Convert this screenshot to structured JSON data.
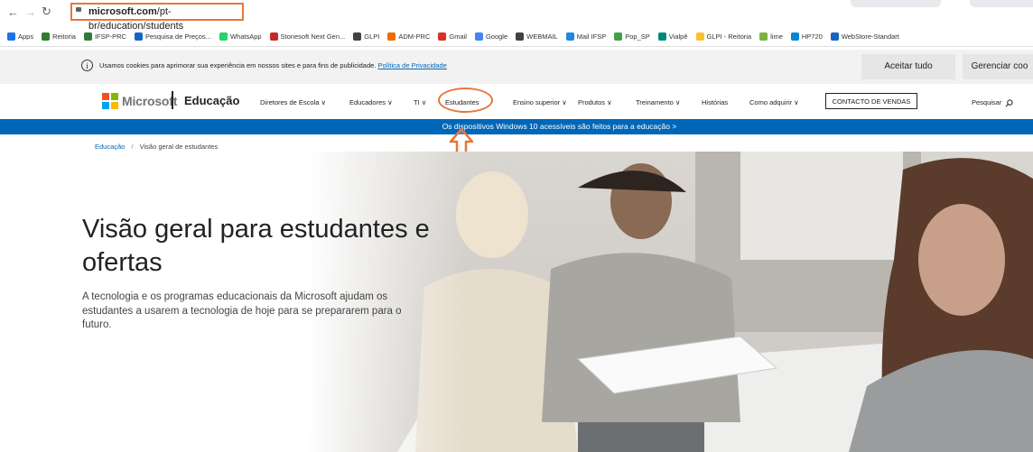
{
  "browser": {
    "url_host": "microsoft.com",
    "url_path": "/pt-br/education/students"
  },
  "bookmarks": [
    {
      "label": "Apps",
      "color": "#1a73e8"
    },
    {
      "label": "Reitoria",
      "color": "#2e7d32"
    },
    {
      "label": "IFSP-PRC",
      "color": "#2e7d32"
    },
    {
      "label": "Pesquisa de Preços...",
      "color": "#1565c0"
    },
    {
      "label": "WhatsApp",
      "color": "#25d366"
    },
    {
      "label": "Stonesoft Next Gen...",
      "color": "#c62828"
    },
    {
      "label": "GLPI",
      "color": "#424242"
    },
    {
      "label": "ADM-PRC",
      "color": "#ef6c00"
    },
    {
      "label": "Gmail",
      "color": "#d93025"
    },
    {
      "label": "Google",
      "color": "#4285f4"
    },
    {
      "label": "WEBMAIL",
      "color": "#424242"
    },
    {
      "label": "Mail IFSP",
      "color": "#1e88e5"
    },
    {
      "label": "Pop_SP",
      "color": "#43a047"
    },
    {
      "label": "Vialpê",
      "color": "#00897b"
    },
    {
      "label": "GLPI - Reitoria",
      "color": "#fbc02d"
    },
    {
      "label": "lime",
      "color": "#7cb342"
    },
    {
      "label": "HP720",
      "color": "#0288d1"
    },
    {
      "label": "WebStore-Standart",
      "color": "#1565c0"
    }
  ],
  "cookie": {
    "text": "Usamos cookies para aprimorar sua experiência em nossos sites e para fins de publicidade.",
    "link": "Política de Privacidade",
    "accept": "Aceitar tudo",
    "manage": "Gerenciar coo"
  },
  "msnav": {
    "brand": "Microsoft",
    "section": "Educação",
    "items": [
      "Diretores de Escola ∨",
      "Educadores ∨",
      "TI ∨",
      "Estudantes",
      "Ensino superior ∨",
      "Produtos ∨",
      "Treinamento ∨",
      "Histórias",
      "Como adquirir ∨"
    ],
    "contact": "CONTACTO DE VENDAS",
    "search": "Pesquisar"
  },
  "banner": "Os dispositivos Windows 10 acessíveis são feitos para a educação >",
  "breadcrumb": {
    "root": "Educação",
    "separator": "/",
    "current": "Visão geral de estudantes"
  },
  "hero": {
    "title": "Visão geral para estudantes e ofertas",
    "subtitle": "A tecnologia e os programas educacionais da Microsoft ajudam os estudantes a usarem a tecnologia de hoje para se prepararem para o futuro."
  },
  "colors": {
    "accent": "#0067b8",
    "highlight": "#e8763a"
  }
}
